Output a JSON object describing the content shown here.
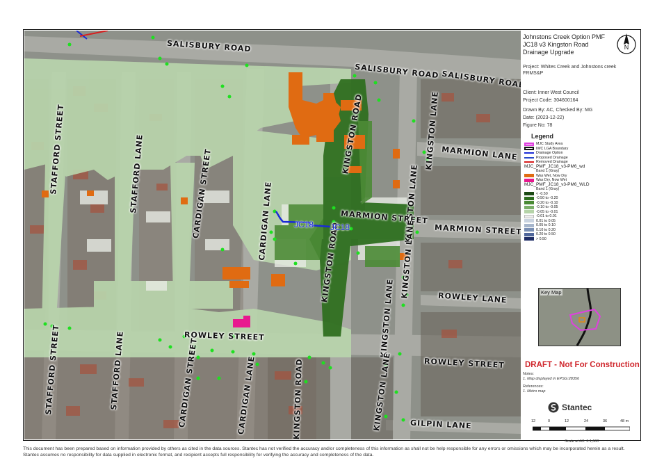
{
  "title": "Johnstons Creek Option PMF JC18 v3 Kingston Road Drainage Upgrade",
  "project_label": "Project:",
  "project": "Whites Creek and Johnstons creek FRMS&P",
  "client": "Client: Inner West Council",
  "project_code": "Project Code: 304600164",
  "drawn_by": "Drawn By: AC, Checked By: MG",
  "date": "Date: (2023-12-22)",
  "figure_no": "Figure No: 78",
  "north_letter": "N",
  "legend": {
    "title": "Legend",
    "items": [
      {
        "label": "MJC Study Area",
        "style": "box",
        "color": "#e040e0"
      },
      {
        "label": "IWC LGA Boundary",
        "style": "box",
        "color": "#111111"
      },
      {
        "label": "Drainage Option",
        "style": "line",
        "color": "#1a2bd6"
      },
      {
        "label": "Proposed Drainage",
        "style": "line",
        "color": "#2a49c9"
      },
      {
        "label": "Removed Drainage",
        "style": "line",
        "color": "#d81e1e"
      }
    ],
    "wd_header": "MJC_PMF_JC18_v3-PM6_wd",
    "wd_band": "Band 1 (Gray)",
    "wd_items": [
      {
        "label": "Was Wet, Now Dry",
        "color": "#e06b12"
      },
      {
        "label": "Was Dry, Now Wet",
        "color": "#e8198f"
      }
    ],
    "wld_header": "MJC_PMF_JC18_v3-PM6_WLD",
    "wld_band": "Band 1 (Gray)",
    "wld_items": [
      {
        "label": "< -0.50",
        "color": "#1c4a14"
      },
      {
        "label": "-0.50 to -0.20",
        "color": "#2e6e1f"
      },
      {
        "label": "-0.20 to -0.10",
        "color": "#4a8a35"
      },
      {
        "label": "-0.10 to -0.05",
        "color": "#7aae68"
      },
      {
        "label": "-0.05 to -0.01",
        "color": "#b5d3a8"
      },
      {
        "label": "-0.01 to 0.01",
        "color": "#eeeeee"
      },
      {
        "label": "0.01 to 0.05",
        "color": "#c9d3e0"
      },
      {
        "label": "0.05 to 0.10",
        "color": "#a6b5cb"
      },
      {
        "label": "0.10 to 0.20",
        "color": "#7a8fb4"
      },
      {
        "label": "0.20 to 0.50",
        "color": "#4f669b"
      },
      {
        "label": "> 0.50",
        "color": "#1f2d66"
      }
    ]
  },
  "keymap_label": "Key Map",
  "draft": "DRAFT - Not For Construction",
  "notes_title": "Notes:",
  "notes_text": "1. Map displayed in EPSG:28356",
  "references_title": "References:",
  "references_text": "1. Metro map",
  "logo_text": "Stantec",
  "scale_ticks": [
    "12",
    "0",
    "12",
    "24",
    "36",
    "48 m"
  ],
  "scale_note": "Scale at A3: 1:1,500",
  "disclaimer": "This document has been prepared based on information provided by others as cited in the data sources. Stantec has not verified the accuracy and/or completeness of this information as shall not be help responsible for any errors or omissions which may be incorporated herein as a result. Stantec assumes no responsibility for data supplied in electronic format, and recipient accepts full responsibility for verifying the accuracy and completeness of the data.",
  "streets": {
    "salisbury_left": "SALISBURY ROAD",
    "salisbury_mid": "SALISBURY ROAD",
    "salisbury_right": "SALISBURY ROAD",
    "stafford_top": "STAFFORD STREET",
    "stafford_lane_top": "STAFFORD LANE",
    "cardigan_top": "CARDIGAN STREET",
    "cardigan_lane_top": "CARDIGAN LANE",
    "kingston_top": "KINGSTON ROAD",
    "kingston_lane_top": "KINGSTON LANE",
    "kingston_lane_top2": "KINGSTON LANE",
    "marmion_lane": "MARMION LANE",
    "marmion_street_mid": "MARMION STREET",
    "marmion_street_right": "MARMION STREET",
    "kingston_road_mid": "KINGSTON ROAD",
    "kingston_lane_mid": "KINGSTON LANE",
    "kingston_lane_mid2": "KINGSTON LANE",
    "rowley_lane": "ROWLEY LANE",
    "rowley_street_left": "ROWLEY STREET",
    "rowley_street_right": "ROWLEY STREET",
    "stafford_bottom": "STAFFORD STREET",
    "stafford_lane_bottom": "STAFFORD LANE",
    "cardigan_bottom": "CARDIGAN STREET",
    "cardigan_lane_bottom": "CARDIGAN LANE",
    "kingston_road_bottom": "KINGSTON ROAD",
    "kingston_lane_bottom": "KINGSTON LANE",
    "gilpin_lane": "GILPIN LANE"
  },
  "drain_labels": [
    "JC18",
    "JC18"
  ]
}
